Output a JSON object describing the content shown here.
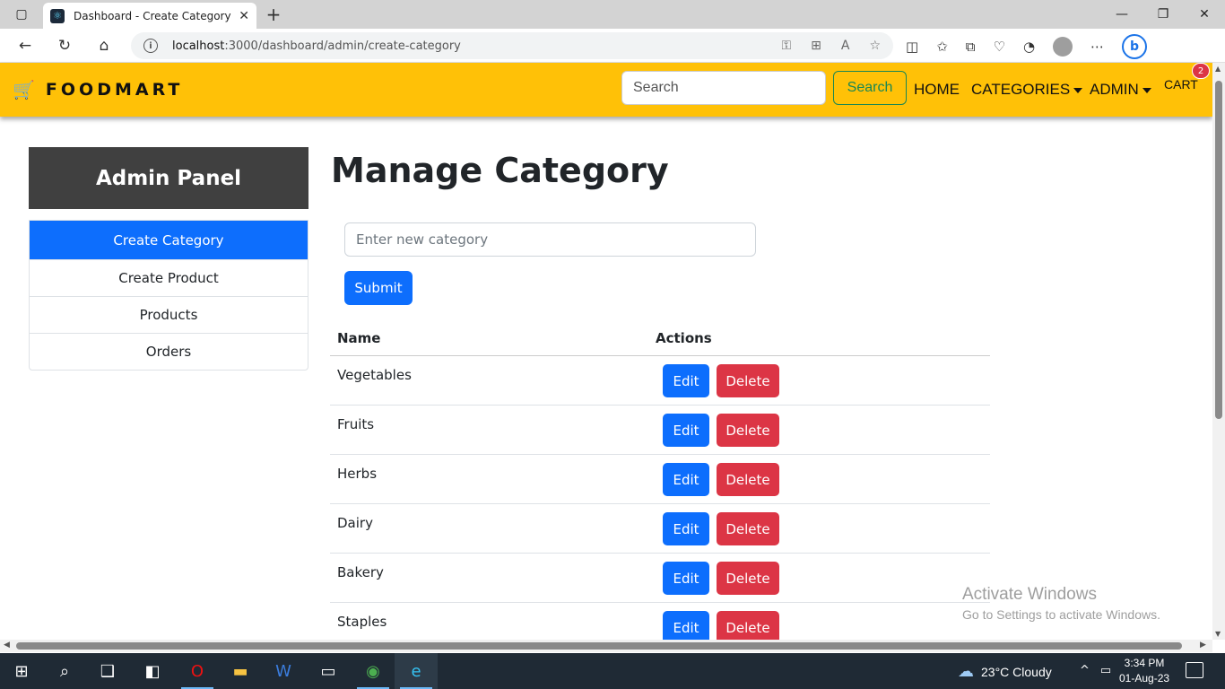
{
  "browser": {
    "tab_title": "Dashboard - Create Category",
    "url_host": "localhost",
    "url_rest": ":3000/dashboard/admin/create-category"
  },
  "navbar": {
    "brand": "FOODMART",
    "search_placeholder": "Search",
    "search_button": "Search",
    "home": "HOME",
    "categories": "CATEGORIES",
    "admin": "ADMIN",
    "cart": "CART",
    "cart_count": "2"
  },
  "sidebar": {
    "title": "Admin Panel",
    "items": [
      {
        "label": "Create Category",
        "active": true
      },
      {
        "label": "Create Product",
        "active": false
      },
      {
        "label": "Products",
        "active": false
      },
      {
        "label": "Orders",
        "active": false
      }
    ]
  },
  "main": {
    "title": "Manage Category",
    "input_placeholder": "Enter new category",
    "submit_label": "Submit",
    "table": {
      "headers": [
        "Name",
        "Actions"
      ],
      "edit_label": "Edit",
      "delete_label": "Delete",
      "rows": [
        "Vegetables",
        "Fruits",
        "Herbs",
        "Dairy",
        "Bakery",
        "Staples"
      ]
    }
  },
  "watermark": {
    "line1": "Activate Windows",
    "line2": "Go to Settings to activate Windows."
  },
  "taskbar": {
    "weather": "23°C  Cloudy",
    "time": "3:34 PM",
    "date": "01-Aug-23"
  },
  "colors": {
    "navbar": "#ffc107",
    "primary": "#0d6efd",
    "danger": "#dc3545",
    "panel_head": "#404040"
  }
}
